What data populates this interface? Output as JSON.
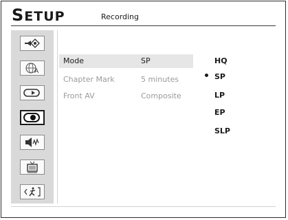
{
  "header": {
    "title_initial": "S",
    "title_rest": "ETUP",
    "section": "Recording"
  },
  "sidebar": {
    "icons": [
      {
        "name": "display-settings-icon",
        "active": false
      },
      {
        "name": "language-settings-icon",
        "active": false
      },
      {
        "name": "playback-settings-icon",
        "active": false
      },
      {
        "name": "recording-settings-icon",
        "active": true
      },
      {
        "name": "audio-settings-icon",
        "active": false
      },
      {
        "name": "tv-settings-icon",
        "active": false
      },
      {
        "name": "exit-icon",
        "active": false
      }
    ]
  },
  "settings": [
    {
      "label": "Mode",
      "value": "SP",
      "selected": true
    },
    {
      "label": "Chapter Mark",
      "value": "5 minutes",
      "selected": false
    },
    {
      "label": "Front AV",
      "value": "Composite",
      "selected": false
    }
  ],
  "options": [
    {
      "label": "HQ",
      "checked": false
    },
    {
      "label": "SP",
      "checked": true
    },
    {
      "label": "LP",
      "checked": false
    },
    {
      "label": "EP",
      "checked": false
    },
    {
      "label": "SLP",
      "checked": false
    }
  ]
}
